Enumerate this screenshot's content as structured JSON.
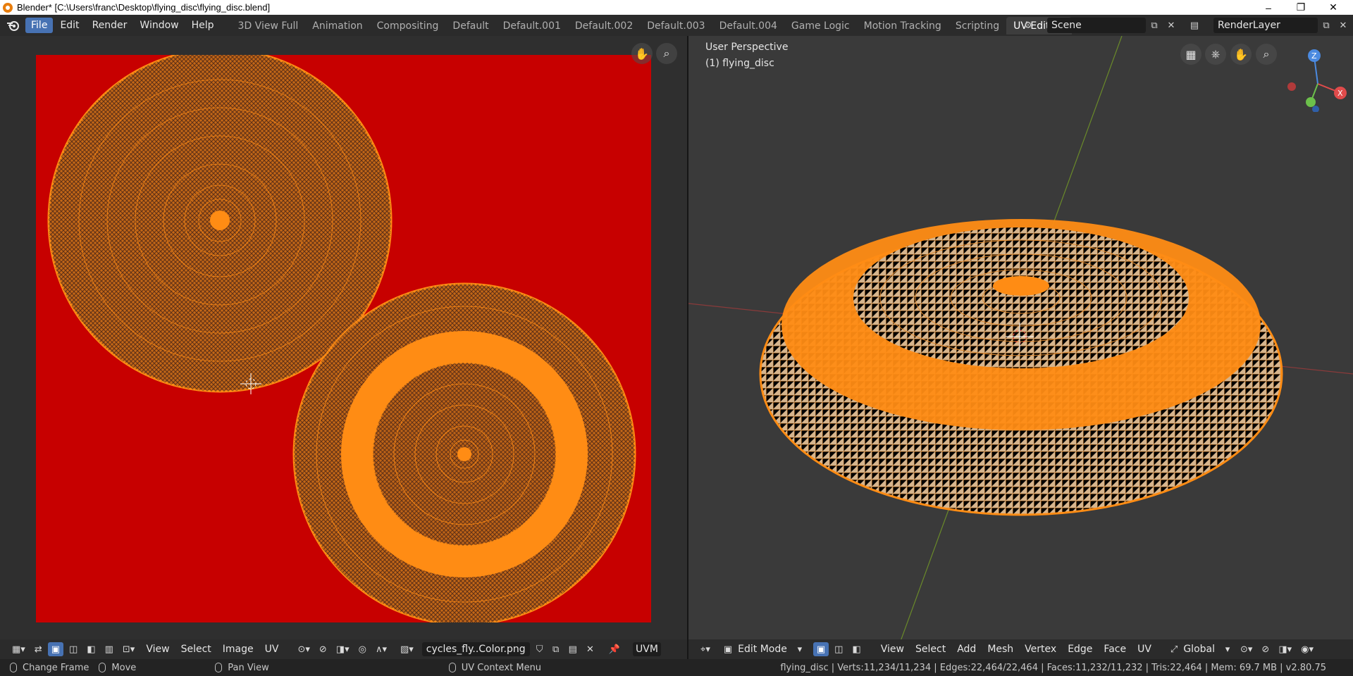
{
  "window": {
    "title": "Blender* [C:\\Users\\franc\\Desktop\\flying_disc\\flying_disc.blend]",
    "minimize": "–",
    "restore": "❐",
    "close": "✕"
  },
  "menu": [
    {
      "label": "File",
      "active": true
    },
    {
      "label": "Edit"
    },
    {
      "label": "Render"
    },
    {
      "label": "Window"
    },
    {
      "label": "Help"
    }
  ],
  "workspace_tabs": [
    {
      "label": "3D View Full"
    },
    {
      "label": "Animation"
    },
    {
      "label": "Compositing"
    },
    {
      "label": "Default"
    },
    {
      "label": "Default.001"
    },
    {
      "label": "Default.002"
    },
    {
      "label": "Default.003"
    },
    {
      "label": "Default.004"
    },
    {
      "label": "Game Logic"
    },
    {
      "label": "Motion Tracking"
    },
    {
      "label": "Scripting"
    },
    {
      "label": "UV Editing",
      "active": true
    }
  ],
  "scene": {
    "value": "Scene"
  },
  "render_layer": {
    "value": "RenderLayer"
  },
  "uv_editor": {
    "header": {
      "menus": [
        "View",
        "Select",
        "Image",
        "UV"
      ],
      "image_name": "cycles_fly..Color.png",
      "uv_map": "UVM"
    },
    "colors": {
      "background": "#c70000",
      "mesh": "#ff8c14",
      "wire": "#3a2a1a"
    }
  },
  "viewport": {
    "perspective": "User Perspective",
    "object": "(1) flying_disc",
    "header": {
      "mode": "Edit Mode",
      "menus": [
        "View",
        "Select",
        "Add",
        "Mesh",
        "Vertex",
        "Edge",
        "Face",
        "UV"
      ],
      "orientation": "Global"
    },
    "gizmo": {
      "z": "Z",
      "x": "X"
    }
  },
  "statusbar": {
    "change_frame": "Change Frame",
    "move": "Move",
    "pan_view": "Pan View",
    "uv_context_menu": "UV Context Menu",
    "stats": "flying_disc | Verts:11,234/11,234 | Edges:22,464/22,464 | Faces:11,232/11,232 | Tris:22,464 | Mem: 69.7 MB | v2.80.75"
  }
}
